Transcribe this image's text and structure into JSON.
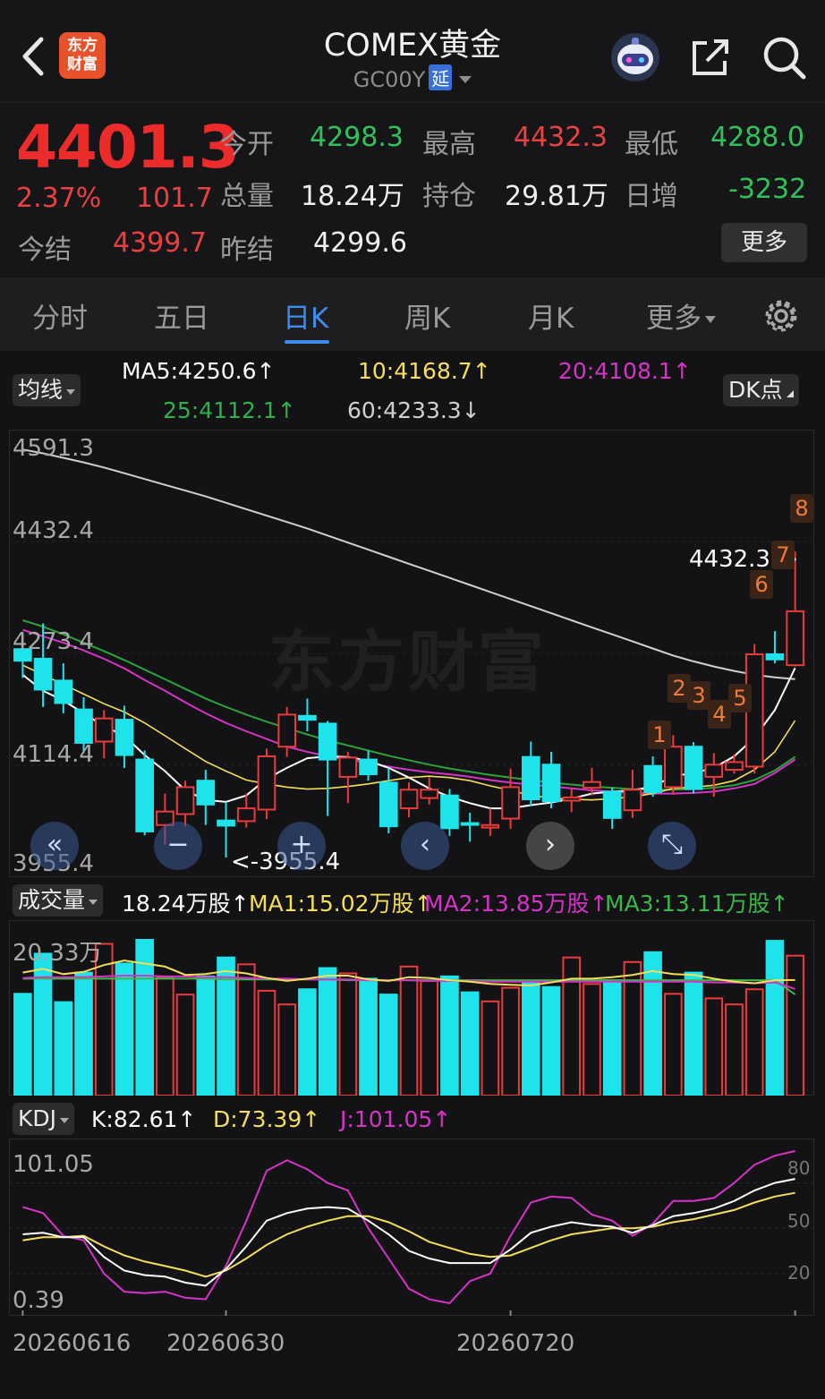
{
  "header": {
    "title": "COMEX黄金",
    "code": "GC00Y",
    "code_tag": "延",
    "logo_text_1": "东方",
    "logo_text_2": "财富"
  },
  "quote": {
    "price": "4401.3",
    "change_pct": "2.37%",
    "change_abs": "101.7",
    "open_label": "今开",
    "open": "4298.3",
    "high_label": "最高",
    "high": "4432.3",
    "low_label": "最低",
    "low": "4288.0",
    "volume_label": "总量",
    "volume": "18.24万",
    "oi_label": "持仓",
    "oi": "29.81万",
    "oi_chg_label": "日增",
    "oi_chg": "-3232",
    "settle_label": "今结",
    "settle": "4399.7",
    "prev_settle_label": "昨结",
    "prev_settle": "4299.6",
    "more": "更多"
  },
  "tabs": [
    {
      "label": "分时"
    },
    {
      "label": "五日"
    },
    {
      "label": "日K"
    },
    {
      "label": "周K"
    },
    {
      "label": "月K"
    },
    {
      "label": "更多"
    }
  ],
  "ma_legend": {
    "selector": "均线",
    "ma5": "MA5:4250.6↑",
    "ma10": "10:4168.7↑",
    "ma20": "20:4108.1↑",
    "ma25": "25:4112.1↑",
    "ma60": "60:4233.3↓",
    "dk": "DK点"
  },
  "vol_legend": {
    "selector": "成交量",
    "vol": "18.24万股↑",
    "ma1": "MA1:15.02万股↑",
    "ma2": "MA2:13.85万股↑",
    "ma3": "MA3:13.11万股↑"
  },
  "kdj_legend": {
    "selector": "KDJ",
    "k": "K:82.61↑",
    "d": "D:73.39↑",
    "j": "J:101.05↑"
  },
  "price_axis": [
    "4591.3",
    "4432.4",
    "4273.4",
    "4114.4",
    "3955.4"
  ],
  "max_label": "4432.3->",
  "min_label": "<-3955.4",
  "vol_axis_max": "20.33万",
  "kdj_axis": {
    "max": "101.05",
    "min": "0.39",
    "r80": "80",
    "r50": "50",
    "r20": "20"
  },
  "dates": [
    "20260616",
    "20260630",
    "20260720"
  ],
  "dk_points": [
    "1",
    "2",
    "3",
    "4",
    "5",
    "6",
    "7",
    "8"
  ],
  "colors": {
    "up": "#e93b3b",
    "down": "#1fe3ea",
    "ma5": "#ffffff",
    "ma10": "#f5de5a",
    "ma20": "#d633c7",
    "ma25": "#2aa33a",
    "ma60": "#d0d0d0",
    "vol_ma1": "#f5de5a",
    "vol_ma2": "#d633c7",
    "vol_ma3": "#3cb84a"
  },
  "chart_data": {
    "type": "candlestick",
    "price_range": [
      3955.4,
      4591.3
    ],
    "candles": [
      {
        "o": 4280,
        "c": 4262,
        "h": 4300,
        "l": 4235
      },
      {
        "o": 4265,
        "c": 4217,
        "h": 4320,
        "l": 4190
      },
      {
        "o": 4231,
        "c": 4196,
        "h": 4258,
        "l": 4180
      },
      {
        "o": 4186,
        "c": 4134,
        "h": 4205,
        "l": 4118
      },
      {
        "o": 4136,
        "c": 4172,
        "h": 4185,
        "l": 4110
      },
      {
        "o": 4170,
        "c": 4115,
        "h": 4192,
        "l": 4095
      },
      {
        "o": 4108,
        "c": 3996,
        "h": 4122,
        "l": 3990
      },
      {
        "o": 4006,
        "c": 4027,
        "h": 4055,
        "l": 3976
      },
      {
        "o": 4023,
        "c": 4065,
        "h": 4075,
        "l": 4004
      },
      {
        "o": 4075,
        "c": 4038,
        "h": 4092,
        "l": 4006
      },
      {
        "o": 4013,
        "c": 4005,
        "h": 4042,
        "l": 3955.4
      },
      {
        "o": 4012,
        "c": 4032,
        "h": 4055,
        "l": 4002
      },
      {
        "o": 4030,
        "c": 4113,
        "h": 4125,
        "l": 4015
      },
      {
        "o": 4128,
        "c": 4178,
        "h": 4190,
        "l": 4112
      },
      {
        "o": 4176,
        "c": 4170,
        "h": 4203,
        "l": 4152
      },
      {
        "o": 4164,
        "c": 4108,
        "h": 4168,
        "l": 4020
      },
      {
        "o": 4081,
        "c": 4111,
        "h": 4120,
        "l": 4040
      },
      {
        "o": 4108,
        "c": 4085,
        "h": 4122,
        "l": 4075
      },
      {
        "o": 4072,
        "c": 4004,
        "h": 4095,
        "l": 3993
      },
      {
        "o": 4032,
        "c": 4061,
        "h": 4072,
        "l": 4018
      },
      {
        "o": 4048,
        "c": 4061,
        "h": 4080,
        "l": 4038
      },
      {
        "o": 4052,
        "c": 4001,
        "h": 4062,
        "l": 3989
      },
      {
        "o": 4009,
        "c": 4007,
        "h": 4025,
        "l": 3980
      },
      {
        "o": 4002,
        "c": 4006,
        "h": 4032,
        "l": 3989
      },
      {
        "o": 4016,
        "c": 4065,
        "h": 4094,
        "l": 4000
      },
      {
        "o": 4112,
        "c": 4046,
        "h": 4136,
        "l": 4035
      },
      {
        "o": 4100,
        "c": 4043,
        "h": 4120,
        "l": 4032
      },
      {
        "o": 4044,
        "c": 4049,
        "h": 4062,
        "l": 4026
      },
      {
        "o": 4064,
        "c": 4073,
        "h": 4095,
        "l": 4052
      },
      {
        "o": 4058,
        "c": 4017,
        "h": 4064,
        "l": 4000
      },
      {
        "o": 4029,
        "c": 4061,
        "h": 4092,
        "l": 4017
      },
      {
        "o": 4098,
        "c": 4057,
        "h": 4113,
        "l": 4050
      },
      {
        "o": 4065,
        "c": 4128,
        "h": 4146,
        "l": 4053
      },
      {
        "o": 4128,
        "c": 4062,
        "h": 4135,
        "l": 4055
      },
      {
        "o": 4081,
        "c": 4100,
        "h": 4118,
        "l": 4050
      },
      {
        "o": 4092,
        "c": 4104,
        "h": 4116,
        "l": 4086
      },
      {
        "o": 4097,
        "c": 4272,
        "h": 4288,
        "l": 4086
      },
      {
        "o": 4272,
        "c": 4264,
        "h": 4308,
        "l": 4258
      },
      {
        "o": 4255,
        "c": 4339,
        "h": 4432.3,
        "l": 4253
      }
    ],
    "ma5": [
      4240,
      4215,
      4200,
      4180,
      4160,
      4145,
      4115,
      4090,
      4060,
      4045,
      4042,
      4052,
      4078,
      4095,
      4110,
      4113,
      4112,
      4106,
      4095,
      4080,
      4063,
      4050,
      4040,
      4032,
      4032,
      4037,
      4041,
      4047,
      4055,
      4058,
      4060,
      4066,
      4082,
      4087,
      4095,
      4113,
      4142,
      4185,
      4250.6
    ],
    "ma10": [
      4255,
      4240,
      4225,
      4210,
      4195,
      4182,
      4165,
      4145,
      4125,
      4105,
      4090,
      4076,
      4070,
      4065,
      4062,
      4063,
      4066,
      4070,
      4075,
      4080,
      4082,
      4080,
      4075,
      4067,
      4060,
      4052,
      4048,
      4046,
      4045,
      4047,
      4050,
      4055,
      4063,
      4065,
      4068,
      4075,
      4092,
      4120,
      4168.7
    ],
    "ma20": [
      4310,
      4300,
      4290,
      4278,
      4265,
      4250,
      4232,
      4215,
      4197,
      4180,
      4165,
      4152,
      4140,
      4128,
      4120,
      4113,
      4108,
      4103,
      4097,
      4092,
      4088,
      4085,
      4081,
      4076,
      4072,
      4069,
      4066,
      4063,
      4060,
      4058,
      4056,
      4055,
      4055,
      4056,
      4058,
      4063,
      4070,
      4087,
      4108.1
    ],
    "ma25": [
      4325,
      4315,
      4303,
      4290,
      4277,
      4263,
      4248,
      4233,
      4218,
      4203,
      4190,
      4178,
      4167,
      4157,
      4147,
      4138,
      4130,
      4122,
      4114,
      4107,
      4100,
      4094,
      4089,
      4084,
      4080,
      4076,
      4072,
      4069,
      4066,
      4064,
      4062,
      4061,
      4061,
      4062,
      4064,
      4068,
      4076,
      4091,
      4112.1
    ],
    "ma60": [
      4591,
      4585,
      4578,
      4571,
      4563,
      4554,
      4545,
      4536,
      4527,
      4518,
      4508,
      4498,
      4488,
      4478,
      4468,
      4457,
      4446,
      4435,
      4424,
      4413,
      4402,
      4391,
      4380,
      4369,
      4358,
      4347,
      4336,
      4325,
      4314,
      4303,
      4292,
      4281,
      4270,
      4261,
      4253,
      4246,
      4240,
      4236,
      4233.3
    ],
    "volume": [
      13.2,
      18.5,
      12.1,
      16.0,
      19.8,
      17.2,
      20.33,
      15.4,
      13.1,
      15.5,
      18.0,
      17.1,
      13.6,
      11.8,
      13.8,
      16.6,
      15.9,
      15.2,
      13.1,
      16.8,
      14.9,
      15.5,
      13.4,
      12.2,
      14.0,
      14.7,
      14.1,
      18.0,
      14.5,
      15.0,
      17.4,
      18.7,
      13.2,
      16.0,
      12.6,
      11.8,
      13.8,
      20.2,
      18.24
    ],
    "vol_ma1": [
      16,
      16.5,
      15.8,
      16.1,
      17.0,
      17.6,
      17.2,
      16.8,
      15.7,
      15.8,
      16.2,
      15.9,
      15.3,
      14.9,
      15.2,
      15.6,
      15.6,
      15.1,
      14.9,
      15.4,
      15.3,
      15.0,
      14.8,
      14.5,
      14.4,
      14.3,
      14.7,
      15.2,
      15.2,
      15.4,
      15.7,
      16.2,
      15.8,
      15.7,
      15.2,
      14.8,
      14.6,
      15.0,
      15.02
    ],
    "vol_ma2": [
      15.3,
      15.4,
      15.4,
      15.4,
      15.5,
      15.6,
      15.6,
      15.5,
      15.5,
      15.4,
      15.4,
      15.3,
      15.2,
      15.2,
      15.1,
      15.1,
      15.1,
      15.0,
      15.0,
      15.0,
      14.9,
      14.9,
      14.9,
      14.8,
      14.8,
      14.8,
      14.8,
      14.8,
      14.8,
      14.8,
      14.8,
      14.8,
      14.8,
      14.8,
      14.7,
      14.7,
      14.6,
      14.7,
      13.85
    ],
    "vol_ma3": [
      15.2,
      15.2,
      15.2,
      15.2,
      15.2,
      15.2,
      15.2,
      15.2,
      15.2,
      15.2,
      15.1,
      15.1,
      15.1,
      15.1,
      15.1,
      15.1,
      15.0,
      15.0,
      15.0,
      15.0,
      15.0,
      15.0,
      15.0,
      15.0,
      15.0,
      15.0,
      15.0,
      15.0,
      15.0,
      15.0,
      15.0,
      15.0,
      15.0,
      15.0,
      15.0,
      15.0,
      15.0,
      15.0,
      13.11
    ],
    "kdj_range": [
      0.39,
      101.05
    ],
    "k": [
      46,
      47,
      44,
      44,
      31,
      22,
      19,
      18,
      14,
      12,
      23,
      38,
      55,
      60,
      63,
      64,
      63,
      55,
      46,
      35,
      30,
      27,
      27,
      27,
      36,
      47,
      51,
      54,
      52,
      51,
      47,
      52,
      58,
      60,
      63,
      68,
      75,
      80,
      82.61
    ],
    "d": [
      42,
      44,
      44,
      45,
      38,
      32,
      28,
      25,
      22,
      18,
      22,
      30,
      39,
      46,
      51,
      55,
      58,
      58,
      54,
      48,
      41,
      37,
      33,
      31,
      32,
      37,
      42,
      46,
      48,
      50,
      50,
      51,
      54,
      56,
      59,
      62,
      67,
      71,
      73.39
    ],
    "j": [
      64,
      60,
      45,
      42,
      20,
      8,
      7,
      8,
      4,
      3,
      25,
      55,
      88,
      95,
      89,
      80,
      75,
      50,
      30,
      10,
      3,
      0.39,
      15,
      20,
      45,
      67,
      71,
      70,
      59,
      55,
      45,
      53,
      68,
      68,
      70,
      80,
      92,
      98,
      101.05
    ]
  }
}
